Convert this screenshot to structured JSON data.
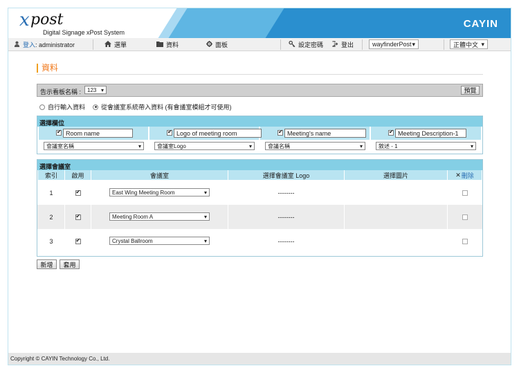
{
  "header": {
    "logo_x": "x",
    "logo_post": "post",
    "logo_sub": "Digital Signage xPost System",
    "brand": "CAYIN"
  },
  "nav": {
    "login_label": "登入",
    "user": ": administrator",
    "menu": "選單",
    "data": "資料",
    "panel": "面板",
    "set_password": "設定密碼",
    "logout": "登出",
    "server_select": "wayfinderPost",
    "language_select": "正體中文"
  },
  "page": {
    "title": "資料",
    "board_label": "告示看板名稱 :",
    "board_value": "123",
    "preview_button": "預覽",
    "radio_manual": "自行輸入資料",
    "radio_meeting": "從會議室系統帶入資料 (有會議室模組才可使用)"
  },
  "field_panel": {
    "title": "選擇欄位",
    "fields": [
      {
        "checked": true,
        "value": "Room name",
        "select": "會議室名稱"
      },
      {
        "checked": true,
        "value": "Logo of meeting room",
        "select": "會議室Logo"
      },
      {
        "checked": true,
        "value": "Meeting's name",
        "select": "會議名稱"
      },
      {
        "checked": true,
        "value": "Meeting Description-1",
        "select": "敘述 - 1"
      }
    ]
  },
  "room_panel": {
    "title": "選擇會議室",
    "headers": {
      "index": "索引",
      "enabled": "啟用",
      "room": "會議室",
      "logo": "選擇會議室 Logo",
      "image": "選擇圖片",
      "delete_x": "✕",
      "delete": "刪除"
    },
    "rows": [
      {
        "index": "1",
        "enabled": true,
        "room": "East Wing Meeting Room",
        "logo": "--------",
        "delete_checked": false
      },
      {
        "index": "2",
        "enabled": true,
        "room": "Meeting Room A",
        "logo": "--------",
        "delete_checked": false
      },
      {
        "index": "3",
        "enabled": true,
        "room": "Crystal Ballroom",
        "logo": "--------",
        "delete_checked": false
      }
    ]
  },
  "buttons": {
    "add": "新增",
    "apply": "套用"
  },
  "footer": {
    "copyright": "Copyright © CAYIN Technology Co., Ltd."
  }
}
